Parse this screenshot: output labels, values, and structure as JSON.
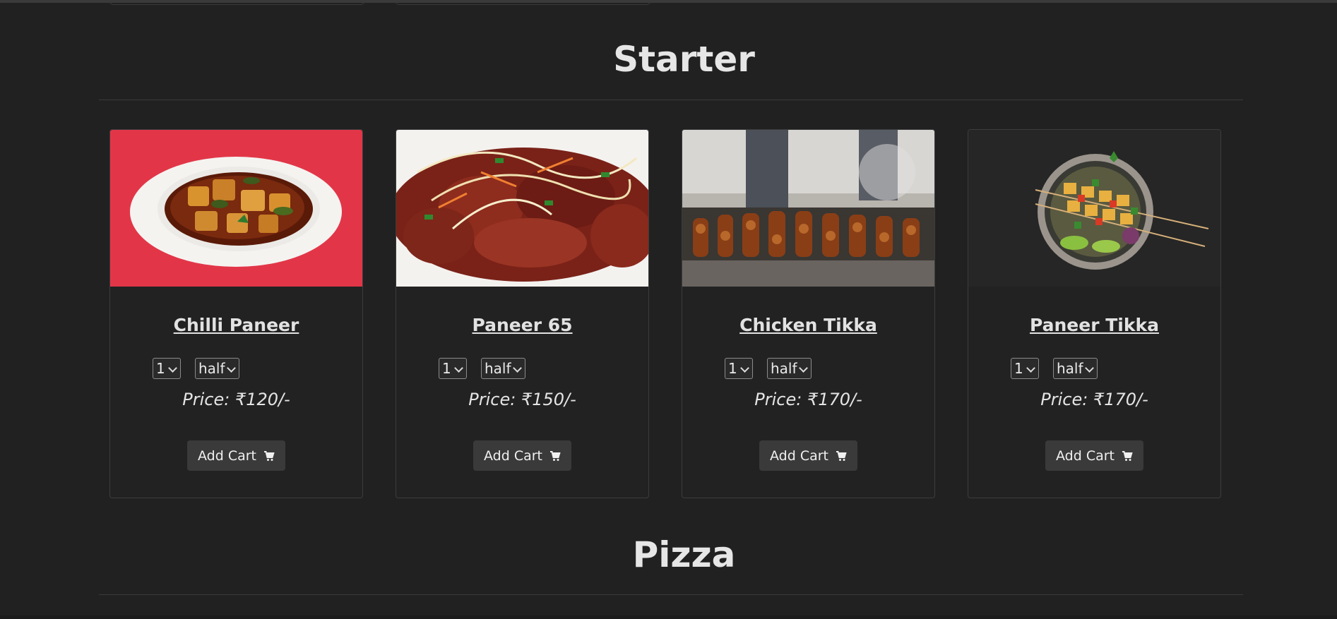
{
  "sections": [
    {
      "title": "Starter"
    },
    {
      "title": "Pizza"
    }
  ],
  "items": [
    {
      "name": "Chilli Paneer",
      "qty": "1",
      "portion": "half",
      "price": "Price: ₹120/-",
      "button": "Add Cart"
    },
    {
      "name": "Paneer 65",
      "qty": "1",
      "portion": "half",
      "price": "Price: ₹150/-",
      "button": "Add Cart"
    },
    {
      "name": "Chicken Tikka",
      "qty": "1",
      "portion": "half",
      "price": "Price: ₹170/-",
      "button": "Add Cart"
    },
    {
      "name": "Paneer Tikka",
      "qty": "1",
      "portion": "half",
      "price": "Price: ₹170/-",
      "button": "Add Cart"
    }
  ],
  "icons": {
    "cart": "cart-icon",
    "dropdown": "chevron-down-icon"
  },
  "colors": {
    "background": "#212121",
    "card_border": "#3c3c3c",
    "button_bg": "#3a3a3a",
    "text": "#e8e8e8"
  }
}
